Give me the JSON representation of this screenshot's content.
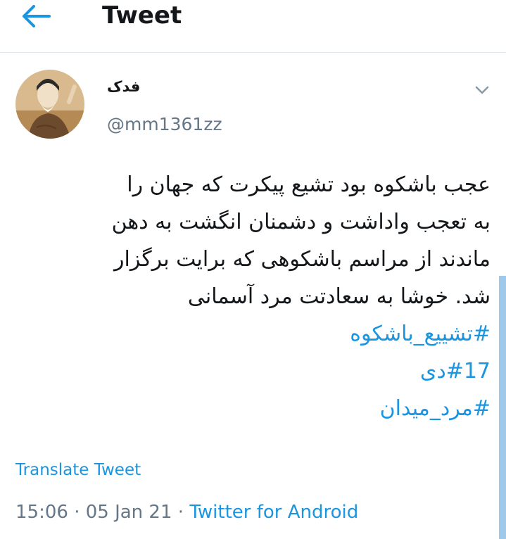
{
  "header": {
    "title": "Tweet",
    "back_icon": "arrow-left-icon"
  },
  "tweet": {
    "author_name": "فدک",
    "author_handle": "@mm1361zz",
    "text_lines": [
      "عجب باشکوه بود تشیع پیکرت که جهان را",
      "به تعجب واداشت و دشمنان انگشت به دهن",
      "ماندند از مراسم باشکوهی که برایت برگزار",
      "شد. خوشا به سعادتت مرد آسمانی"
    ],
    "hashtags": [
      "#تشییع_باشکوه",
      "#17دی",
      "#مرد_میدان"
    ],
    "translate_label": "Translate Tweet",
    "time": "15:06",
    "date": "05 Jan 21",
    "source": "Twitter for Android",
    "separator": " · "
  },
  "colors": {
    "accent": "#1b95e0",
    "secondary_text": "#657786"
  }
}
